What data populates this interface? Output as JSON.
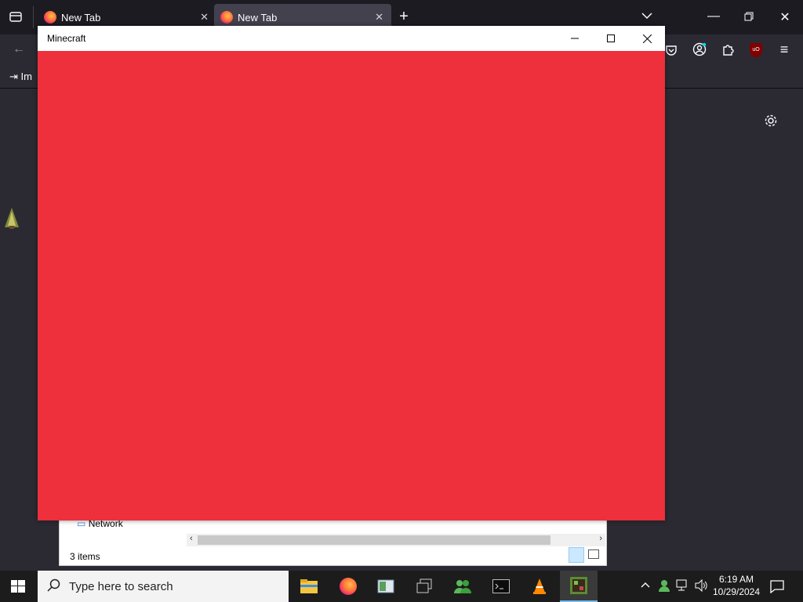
{
  "browser": {
    "tabs": [
      {
        "label": "New Tab"
      },
      {
        "label": "New Tab"
      }
    ],
    "bookmarks_import_label": "Im"
  },
  "minecraft": {
    "title": "Minecraft",
    "background_color": "#ee2f3c"
  },
  "explorer": {
    "nav_item": "Network",
    "status": "3 items"
  },
  "taskbar": {
    "search_placeholder": "Type here to search",
    "time": "6:19 AM",
    "date": "10/29/2024"
  }
}
